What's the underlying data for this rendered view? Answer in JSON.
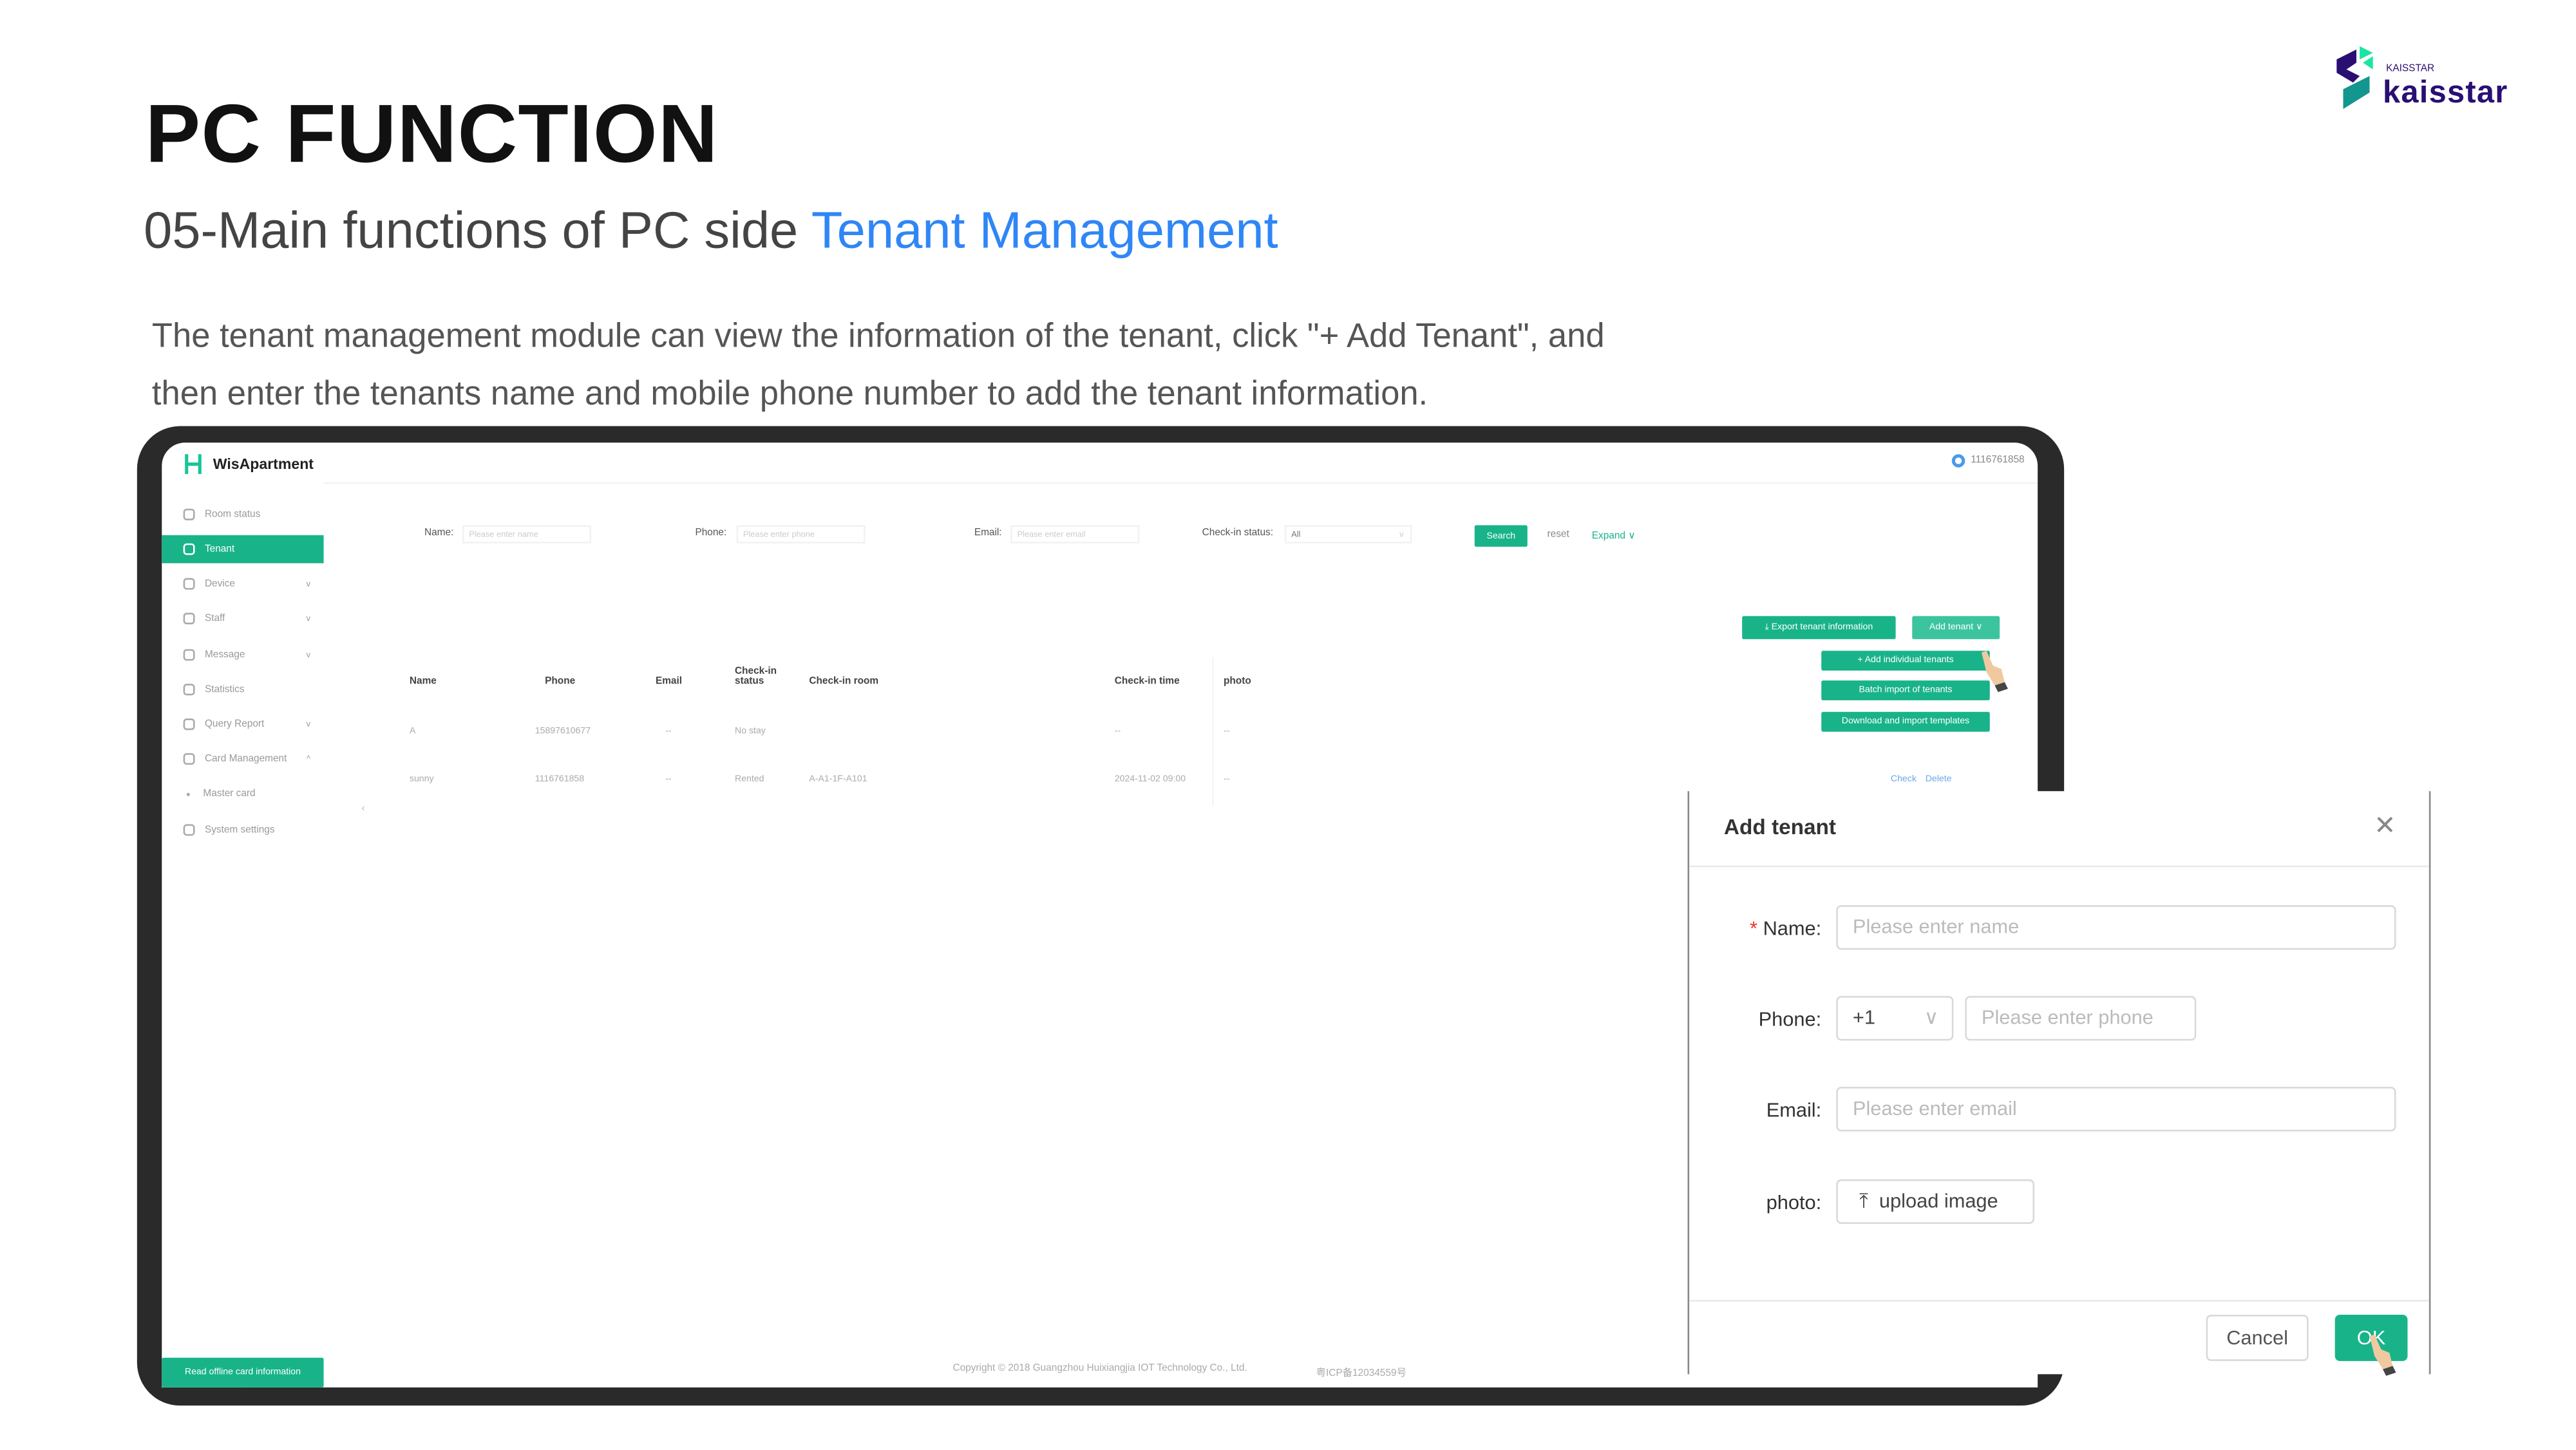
{
  "slide": {
    "title": "PC FUNCTION",
    "subtitle_prefix": "05-Main functions of PC side ",
    "subtitle_highlight": "Tenant Management",
    "description_line1": "The tenant management module can view the information of the tenant, click \"+ Add Tenant\", and",
    "description_line2": "then enter the tenants name and mobile phone number to add the tenant information.",
    "brand_logo": {
      "small_text": "KAISSTAR",
      "large_text": "kaisstar",
      "colors": [
        "#2a0f73",
        "#19e6a0",
        "#13968e"
      ]
    }
  },
  "app": {
    "name": "WisApartment",
    "user": "1116761858",
    "accent": "#19b38a",
    "sidebar": [
      {
        "label": "Room status",
        "icon": "home-icon",
        "chevron": ""
      },
      {
        "label": "Tenant",
        "icon": "user-icon",
        "chevron": "",
        "active": true
      },
      {
        "label": "Device",
        "icon": "device-icon",
        "chevron": "v"
      },
      {
        "label": "Staff",
        "icon": "staff-icon",
        "chevron": "v"
      },
      {
        "label": "Message",
        "icon": "bell-icon",
        "chevron": "v"
      },
      {
        "label": "Statistics",
        "icon": "chart-icon",
        "chevron": ""
      },
      {
        "label": "Query Report",
        "icon": "report-icon",
        "chevron": "v"
      },
      {
        "label": "Card Management",
        "icon": "card-icon",
        "chevron": "^"
      },
      {
        "label": "Master card",
        "icon": "dot-icon",
        "chevron": ""
      },
      {
        "label": "System settings",
        "icon": "gear-icon",
        "chevron": ""
      }
    ],
    "sidebar_bottom": "Read offline card information",
    "filters": {
      "name_label": "Name:",
      "name_placeholder": "Please enter name",
      "phone_label": "Phone:",
      "phone_placeholder": "Please enter phone",
      "email_label": "Email:",
      "email_placeholder": "Please enter email",
      "status_label": "Check-in status:",
      "status_value": "All",
      "search": "Search",
      "reset": "reset",
      "expand": "Expand"
    },
    "actions": {
      "export": "Export tenant information",
      "add_tenant": "Add tenant",
      "dropdown": [
        "+ Add individual tenants",
        "Batch import of tenants",
        "Download and import templates"
      ]
    },
    "table": {
      "headers": [
        "Name",
        "Phone",
        "Email",
        "Check-in status",
        "Check-in room",
        "Check-in time",
        "photo"
      ],
      "rows": [
        [
          "A",
          "15897610677",
          "--",
          "No stay",
          "",
          "--",
          "--"
        ],
        [
          "sunny",
          "1116761858",
          "--",
          "Rented",
          "A-A1-1F-A101",
          "2024-11-02 09:00",
          "--"
        ]
      ],
      "row_actions": [
        "Check",
        "Delete"
      ]
    },
    "footer": {
      "copyright": "Copyright © 2018 Guangzhou Huixiangjia IOT Technology Co., Ltd.",
      "icp": "粤ICP备12034559号"
    }
  },
  "modal": {
    "title": "Add tenant",
    "required_mark": "*",
    "name_label": "Name:",
    "name_placeholder": "Please enter name",
    "phone_label": "Phone:",
    "country_code": "+1",
    "phone_placeholder": "Please enter phone",
    "email_label": "Email:",
    "email_placeholder": "Please enter email",
    "photo_label": "photo:",
    "upload": "upload image",
    "cancel": "Cancel",
    "ok": "OK"
  }
}
